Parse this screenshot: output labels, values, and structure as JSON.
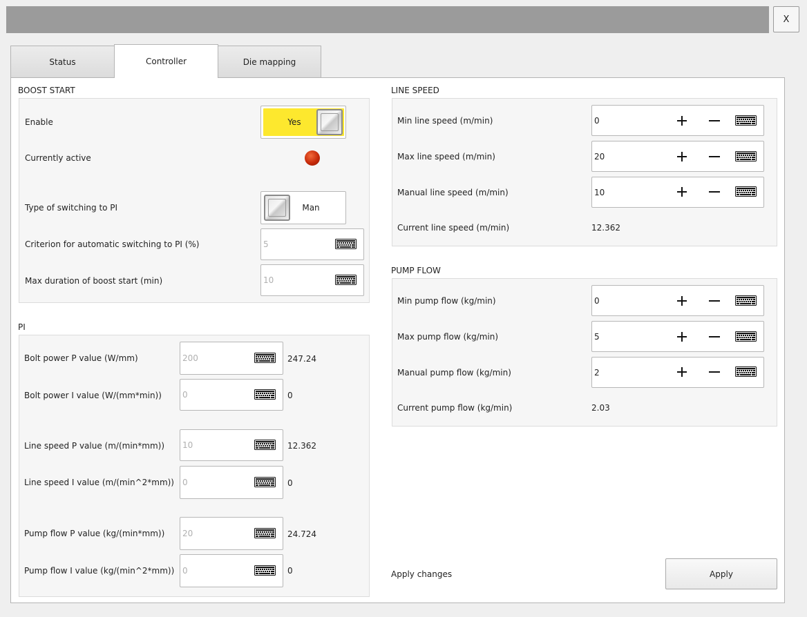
{
  "window": {
    "close_label": "X"
  },
  "tabs": [
    {
      "label": "Status"
    },
    {
      "label": "Controller",
      "active": true
    },
    {
      "label": "Die mapping"
    }
  ],
  "boost_start": {
    "title": "BOOST START",
    "enable": {
      "label": "Enable",
      "value": "Yes",
      "color": "#fde82e"
    },
    "currently_active": {
      "label": "Currently active",
      "indicator_color": "#c62a0a"
    },
    "switching_type": {
      "label": "Type of switching to PI",
      "value": "Man"
    },
    "criterion": {
      "label": "Criterion for automatic switching to PI (%)",
      "value": "5"
    },
    "max_duration": {
      "label": "Max duration of boost start (min)",
      "value": "10"
    }
  },
  "pi": {
    "title": "PI",
    "rows": [
      {
        "label": "Bolt power P value (W/mm)",
        "input": "200",
        "current": "247.24"
      },
      {
        "label": "Bolt power I value (W/(mm*min))",
        "input": "0",
        "current": "0"
      },
      {
        "label": "Line speed P value (m/(min*mm))",
        "input": "10",
        "current": "12.362"
      },
      {
        "label": "Line speed I value (m/(min^2*mm))",
        "input": "0",
        "current": "0"
      },
      {
        "label": "Pump flow P value (kg/(min*mm))",
        "input": "20",
        "current": "24.724"
      },
      {
        "label": "Pump flow I value (kg/(min^2*mm))",
        "input": "0",
        "current": "0"
      }
    ]
  },
  "line_speed": {
    "title": "LINE SPEED",
    "rows": [
      {
        "label": "Min line speed (m/min)",
        "value": "0"
      },
      {
        "label": "Max line speed (m/min)",
        "value": "20"
      },
      {
        "label": "Manual line speed (m/min)",
        "value": "10"
      }
    ],
    "current": {
      "label": "Current line speed (m/min)",
      "value": "12.362"
    }
  },
  "pump_flow": {
    "title": "PUMP FLOW",
    "rows": [
      {
        "label": "Min pump flow (kg/min)",
        "value": "0"
      },
      {
        "label": "Max pump flow (kg/min)",
        "value": "5"
      },
      {
        "label": "Manual pump flow (kg/min)",
        "value": "2"
      }
    ],
    "current": {
      "label": "Current pump flow (kg/min)",
      "value": "2.03"
    }
  },
  "apply": {
    "label": "Apply changes",
    "button": "Apply"
  },
  "icons": {
    "keyboard": "keyboard-icon",
    "plus": "plus-icon",
    "minus": "minus-icon",
    "close": "close-icon"
  }
}
